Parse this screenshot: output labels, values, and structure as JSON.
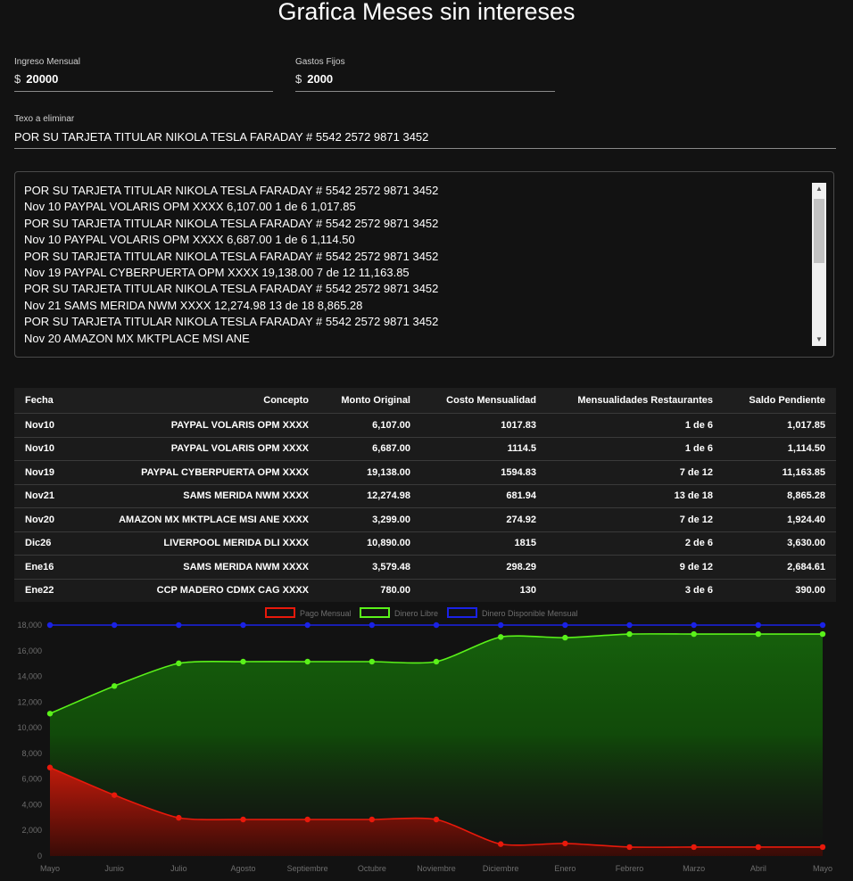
{
  "page": {
    "title": "Grafica Meses sin intereses"
  },
  "inputs": {
    "ingreso": {
      "label": "Ingreso Mensual",
      "prefix": "$",
      "value": "20000"
    },
    "gastos": {
      "label": "Gastos Fijos",
      "prefix": "$",
      "value": "2000"
    },
    "texto": {
      "label": "Texo a eliminar",
      "value": "POR SU TARJETA TITULAR NIKOLA TESLA FARADAY # 5542 2572 9871 3452"
    }
  },
  "textarea": {
    "lines": [
      "POR SU TARJETA TITULAR NIKOLA TESLA FARADAY # 5542 2572 9871 3452",
      "Nov 10 PAYPAL VOLARIS OPM XXXX 6,107.00 1 de 6 1,017.85",
      "POR SU TARJETA TITULAR NIKOLA TESLA FARADAY # 5542 2572 9871 3452",
      "Nov 10 PAYPAL VOLARIS OPM XXXX 6,687.00 1 de 6 1,114.50",
      "POR SU TARJETA TITULAR NIKOLA TESLA FARADAY # 5542 2572 9871 3452",
      "Nov 19 PAYPAL CYBERPUERTA OPM XXXX 19,138.00 7 de 12 11,163.85",
      "POR SU TARJETA TITULAR NIKOLA TESLA FARADAY # 5542 2572 9871 3452",
      "Nov 21 SAMS MERIDA NWM XXXX 12,274.98 13 de 18 8,865.28",
      "POR SU TARJETA TITULAR NIKOLA TESLA FARADAY # 5542 2572 9871 3452",
      "Nov 20 AMAZON MX MKTPLACE MSI ANE"
    ]
  },
  "table": {
    "headers": [
      "Fecha",
      "Concepto",
      "Monto Original",
      "Costo Mensualidad",
      "Mensualidades Restaurantes",
      "Saldo Pendiente"
    ],
    "rows": [
      [
        "Nov10",
        "PAYPAL VOLARIS OPM XXXX",
        "6,107.00",
        "1017.83",
        "1 de 6",
        "1,017.85"
      ],
      [
        "Nov10",
        "PAYPAL VOLARIS OPM XXXX",
        "6,687.00",
        "1114.5",
        "1 de 6",
        "1,114.50"
      ],
      [
        "Nov19",
        "PAYPAL CYBERPUERTA OPM XXXX",
        "19,138.00",
        "1594.83",
        "7 de 12",
        "11,163.85"
      ],
      [
        "Nov21",
        "SAMS MERIDA NWM XXXX",
        "12,274.98",
        "681.94",
        "13 de 18",
        "8,865.28"
      ],
      [
        "Nov20",
        "AMAZON MX MKTPLACE MSI ANE XXXX",
        "3,299.00",
        "274.92",
        "7 de 12",
        "1,924.40"
      ],
      [
        "Dic26",
        "LIVERPOOL MERIDA DLI XXXX",
        "10,890.00",
        "1815",
        "2 de 6",
        "3,630.00"
      ],
      [
        "Ene16",
        "SAMS MERIDA NWM XXXX",
        "3,579.48",
        "298.29",
        "9 de 12",
        "2,684.61"
      ],
      [
        "Ene22",
        "CCP MADERO CDMX CAG XXXX",
        "780.00",
        "130",
        "3 de 6",
        "390.00"
      ]
    ]
  },
  "colors": {
    "background": "#121212",
    "pago": "#e8190b",
    "libre": "#5af21a",
    "disponible": "#1a22e6"
  },
  "chart_data": {
    "type": "area",
    "categories": [
      "Mayo",
      "Junio",
      "Julio",
      "Agosto",
      "Septiembre",
      "Octubre",
      "Noviembre",
      "Diciembre",
      "Enero",
      "Febrero",
      "Marzo",
      "Abril",
      "Mayo"
    ],
    "series": [
      {
        "name": "Pago Mensual",
        "color": "#e8190b",
        "values": [
          6900,
          4750,
          2980,
          2850,
          2850,
          2850,
          2850,
          930,
          980,
          700,
          700,
          700,
          700
        ]
      },
      {
        "name": "Dinero Libre",
        "color": "#5af21a",
        "values": [
          11100,
          13250,
          15020,
          15150,
          15150,
          15150,
          15150,
          17070,
          17020,
          17300,
          17300,
          17300,
          17300
        ]
      },
      {
        "name": "Dinero Disponible Mensual",
        "color": "#1a22e6",
        "values": [
          18000,
          18000,
          18000,
          18000,
          18000,
          18000,
          18000,
          18000,
          18000,
          18000,
          18000,
          18000,
          18000
        ]
      }
    ],
    "yticks": [
      "0",
      "2,000",
      "4,000",
      "6,000",
      "8,000",
      "10,000",
      "12,000",
      "14,000",
      "16,000",
      "18,000"
    ],
    "ylim": [
      0,
      18000
    ],
    "legend_position": "top",
    "grid": false,
    "title": "",
    "xlabel": "",
    "ylabel": ""
  }
}
